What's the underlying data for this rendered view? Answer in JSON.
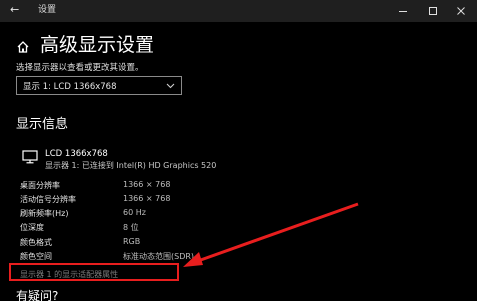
{
  "window": {
    "back_glyph": "←",
    "title": "设置",
    "controls": [
      "minimize-icon",
      "maximize-icon",
      "close-icon"
    ]
  },
  "header": {
    "home_icon": "home-icon",
    "title": "高级显示设置"
  },
  "display_select": {
    "prompt": "选择显示器以查看或更改其设置。",
    "selected": "显示 1: LCD 1366x768",
    "chevron_icon": "chevron-down-icon"
  },
  "display_info": {
    "section_title": "显示信息",
    "monitor_icon": "monitor-icon",
    "monitor_name": "LCD 1366x768",
    "connection": "显示器 1: 已连接到 Intel(R) HD Graphics 520",
    "rows": [
      {
        "label": "桌面分辨率",
        "value": "1366 × 768"
      },
      {
        "label": "活动信号分辨率",
        "value": "1366 × 768"
      },
      {
        "label": "刷新频率(Hz)",
        "value": "60 Hz"
      },
      {
        "label": "位深度",
        "value": "8 位"
      },
      {
        "label": "颜色格式",
        "value": "RGB"
      },
      {
        "label": "颜色空间",
        "value": "标准动态范围(SDR)"
      }
    ],
    "adapter_link": "显示器 1 的显示适配器属性"
  },
  "help": {
    "title": "有疑问?"
  },
  "colors": {
    "background": "#000000",
    "titlebar": "#1f1f1f",
    "annotation": "#e81e1e",
    "link_muted": "#7a7a7a"
  }
}
